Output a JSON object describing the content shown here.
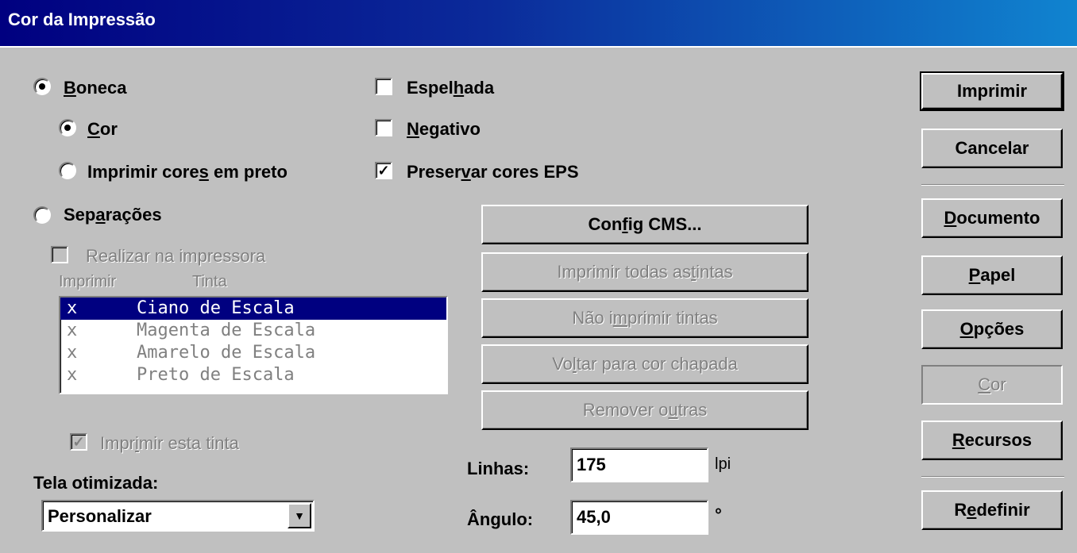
{
  "window": {
    "title": "Cor da Impressão"
  },
  "options": {
    "boneca": {
      "label_pre": "",
      "label_u": "B",
      "label_post": "oneca",
      "selected": true
    },
    "cor": {
      "label_pre": "",
      "label_u": "C",
      "label_post": "or",
      "selected": true
    },
    "imprimir_preto": {
      "label_pre": "Imprimir core",
      "label_u": "s",
      "label_post": " em preto",
      "selected": false
    },
    "separacoes": {
      "label_pre": "Sep",
      "label_u": "a",
      "label_post": "rações",
      "selected": false
    },
    "realizar": {
      "label": "Realizar na impressora",
      "checked": false
    }
  },
  "checks": {
    "espelhada": {
      "label_pre": "Espel",
      "label_u": "h",
      "label_post": "ada",
      "checked": false
    },
    "negativo": {
      "label_pre": "",
      "label_u": "N",
      "label_post": "egativo",
      "checked": false
    },
    "preservar": {
      "label_pre": "Preser",
      "label_u": "v",
      "label_post": "ar cores EPS",
      "checked": true
    }
  },
  "ink_list": {
    "header_print": "Imprimir",
    "header_ink": "Tinta",
    "rows": [
      {
        "mark": "x",
        "name": "Ciano de Escala",
        "selected": true
      },
      {
        "mark": "x",
        "name": "Magenta de Escala",
        "selected": false
      },
      {
        "mark": "x",
        "name": "Amarelo de Escala",
        "selected": false
      },
      {
        "mark": "x",
        "name": "Preto de Escala",
        "selected": false
      }
    ]
  },
  "print_this_ink": {
    "label_pre": "Impr",
    "label_u": "i",
    "label_post": "mir esta tinta",
    "checked": true
  },
  "screen": {
    "label": "Tela otimizada:",
    "value": "Personalizar"
  },
  "mid_buttons": {
    "config_cms": {
      "pre": "Con",
      "u": "f",
      "post": "ig CMS..."
    },
    "print_all": {
      "pre": "Imprimir todas as ",
      "u": "t",
      "post": "intas"
    },
    "no_print": {
      "pre": "Não i",
      "u": "m",
      "post": "primir tintas"
    },
    "back_solid": {
      "pre": "Vo",
      "u": "l",
      "post": "tar para cor chapada"
    },
    "remove_others": {
      "pre": "Remover o",
      "u": "u",
      "post": "tras"
    }
  },
  "lines": {
    "label": "Linhas:",
    "value": "175",
    "unit": "lpi"
  },
  "angle": {
    "label": "Ângulo:",
    "value": "45,0",
    "unit": "°"
  },
  "right_buttons": {
    "imprimir": "Imprimir",
    "cancelar": "Cancelar",
    "documento": {
      "u": "D",
      "post": "ocumento"
    },
    "papel": {
      "u": "P",
      "post": "apel"
    },
    "opcoes": {
      "u": "O",
      "post": "pções"
    },
    "cor": {
      "u": "C",
      "post": "or"
    },
    "recursos": {
      "u": "R",
      "post": "ecursos"
    },
    "redefinir": {
      "pre": "R",
      "u": "e",
      "post": "definir"
    }
  }
}
